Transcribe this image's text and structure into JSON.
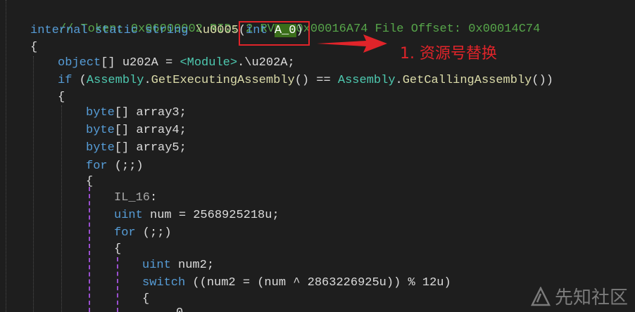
{
  "code": {
    "comment": "// Token: 0x06000002 RID: 2 RVA: 0x00016A74 File Offset: 0x00014C74",
    "kw_internal": "internal",
    "kw_static": "static",
    "kw_string": "string",
    "method_name": "\\u0005",
    "kw_int": "int",
    "param_name": "A_0",
    "paren_open": "(",
    "paren_close": ")",
    "brace_open": "{",
    "l4_type": "object",
    "l4_rest_a": "[] u202A = ",
    "l4_module": "<Module>",
    "l4_rest_b": ".\\u202A;",
    "l5_if": "if",
    "l5_p1": " (",
    "l5_assembly1": "Assembly",
    "l5_dot1": ".",
    "l5_fn1": "GetExecutingAssembly",
    "l5_mid": "() == ",
    "l5_assembly2": "Assembly",
    "l5_dot2": ".",
    "l5_fn2": "GetCallingAssembly",
    "l5_end": "())",
    "l7_type": "byte",
    "l7_rest": "[] array3;",
    "l8_type": "byte",
    "l8_rest": "[] array4;",
    "l9_type": "byte",
    "l9_rest": "[] array5;",
    "l10_for": "for",
    "l10_rest": " (;;)",
    "l12_label": "IL_16",
    "l12_colon": ":",
    "l13_type": "uint",
    "l13_rest_a": " num = ",
    "l13_num": "2568925218u",
    "l13_rest_b": ";",
    "l14_for": "for",
    "l14_rest": " (;;)",
    "l16_type": "uint",
    "l16_rest": " num2;",
    "l17_switch": "switch",
    "l17_rest_a": " ((num2 = (num ^ ",
    "l17_num1": "2863226925u",
    "l17_rest_b": ")) % ",
    "l17_num2": "12u",
    "l17_rest_c": ")",
    "l19_partial": "0"
  },
  "annotation": {
    "text": "1. 资源号替换",
    "color": "#e0242a"
  },
  "watermark": {
    "text": "先知社区",
    "icon": "xianzhi-logo-icon"
  },
  "colors": {
    "background": "#1e1e1e",
    "keyword": "#569cd6",
    "comment": "#57a64a",
    "type": "#4ec9b0",
    "method": "#dcdcaa",
    "number": "#b5cea8",
    "highlight": "#3a6e1a"
  }
}
